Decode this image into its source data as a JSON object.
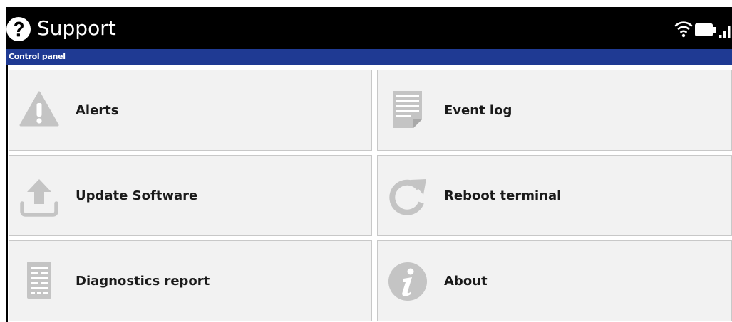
{
  "app": {
    "title": "Support",
    "icon": "help-circle-icon",
    "status_icons": [
      "wifi-icon",
      "battery-icon",
      "signal-bars-icon"
    ]
  },
  "breadcrumb": {
    "label": "Control panel"
  },
  "tiles": [
    {
      "label": "Alerts",
      "icon": "warning-icon"
    },
    {
      "label": "Event log",
      "icon": "document-log-icon"
    },
    {
      "label": "Update Software",
      "icon": "upload-icon"
    },
    {
      "label": "Reboot terminal",
      "icon": "refresh-icon"
    },
    {
      "label": "Diagnostics report",
      "icon": "report-icon"
    },
    {
      "label": "About",
      "icon": "info-icon"
    }
  ],
  "colors": {
    "titlebar": "#000000",
    "breadcrumb_bar": "#1f3a93",
    "tile_background": "#f2f2f2",
    "icon_gray": "#c4c4c4"
  }
}
